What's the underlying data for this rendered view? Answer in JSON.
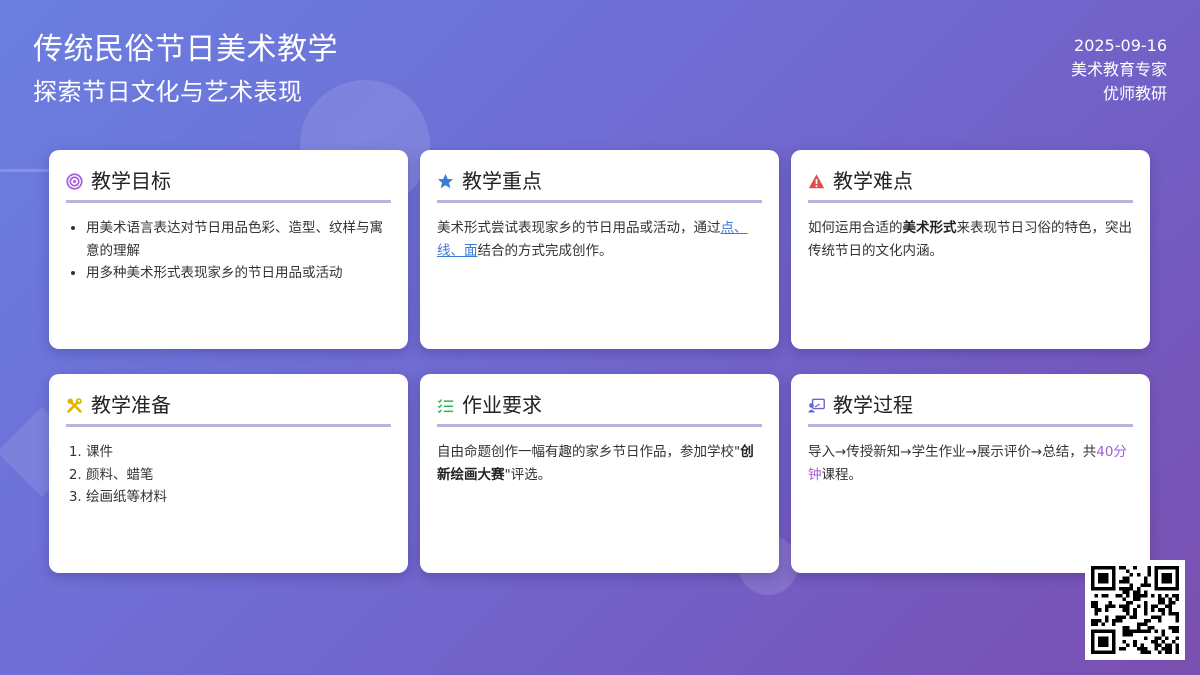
{
  "header": {
    "title": "传统民俗节日美术教学",
    "subtitle": "探索节日文化与艺术表现",
    "date": "2025-09-16",
    "author": "美术教育专家",
    "org": "优师教研"
  },
  "cards": [
    {
      "title": "教学目标",
      "icon": "target-icon",
      "items": [
        "用美术语言表达对节日用品色彩、造型、纹样与寓意的理解",
        "用多种美术形式表现家乡的节日用品或活动"
      ]
    },
    {
      "title": "教学重点",
      "icon": "star-icon",
      "text_before": "美术形式尝试表现家乡的节日用品或活动，通过",
      "link": "点、线、面",
      "text_after": "结合的方式完成创作。"
    },
    {
      "title": "教学难点",
      "icon": "warning-icon",
      "text_before": "如何运用合适的",
      "bold": "美术形式",
      "text_after": "来表现节日习俗的特色，突出传统节日的文化内涵。"
    },
    {
      "title": "教学准备",
      "icon": "tools-icon",
      "items": [
        "课件",
        "颜料、蜡笔",
        "绘画纸等材料"
      ]
    },
    {
      "title": "作业要求",
      "icon": "checklist-icon",
      "text_before": "自由命题创作一幅有趣的家乡节日作品，参加学校\"",
      "bold": "创新绘画大赛",
      "text_after": "\"评选。"
    },
    {
      "title": "教学过程",
      "icon": "presentation-icon",
      "text_before": "导入→传授新知→学生作业→展示评价→总结，共",
      "accent": "40分钟",
      "text_after": "课程。"
    }
  ],
  "colors": {
    "bg_start": "#6a7fe0",
    "bg_end": "#7a4fb0",
    "target": "#a15ed8",
    "star": "#3a7bd5",
    "warning": "#e04b4b",
    "tools": "#e0b400",
    "checklist": "#2fb84f",
    "presentation": "#6a63d8"
  }
}
